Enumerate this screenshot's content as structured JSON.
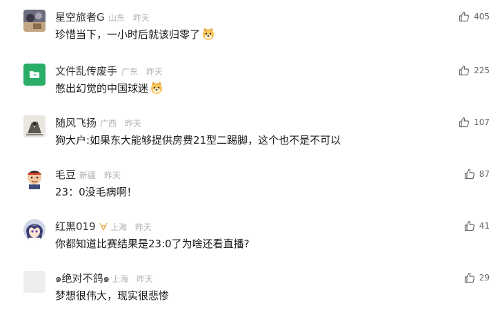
{
  "comments": [
    {
      "name": "星空旅者G",
      "location": "山东",
      "time": "昨天",
      "text": "珍惜当下，一小时后就该归零了",
      "likes": "405",
      "avatar": "photo-avatar",
      "emoji": "dog-face-emoji"
    },
    {
      "name": "文件乱传废手",
      "location": "广东",
      "time": "昨天",
      "text": "憋出幻觉的中国球迷",
      "likes": "225",
      "avatar": "folder-icon",
      "emoji": "dog-face-emoji"
    },
    {
      "name": "随风飞扬",
      "location": "广西",
      "time": "昨天",
      "text": "狗大户:如果东大能够提供房费21型二踢脚，这个也不是不可以",
      "likes": "107",
      "avatar": "photo-avatar"
    },
    {
      "name": "毛豆",
      "location": "新疆",
      "time": "昨天",
      "text": "23：0没毛病啊！",
      "likes": "87",
      "avatar": "cartoon-avatar"
    },
    {
      "name": "红黑019",
      "location": "上海",
      "time": "昨天",
      "text": "你都知道比赛结果是23:0了为啥还看直播?",
      "likes": "41",
      "avatar": "anime-avatar",
      "badge": "ribbon-badge-icon"
    },
    {
      "name": "๑绝对不鸽๑",
      "location": "上海",
      "time": "昨天",
      "text": "梦想很伟大，现实很悲惨",
      "likes": "29",
      "avatar": "blank-avatar"
    }
  ],
  "colors": {
    "folder_green": "#2aae67",
    "like_gray": "#666666",
    "meta_gray": "#b2b2b2",
    "badge_gold": "#e8b04a"
  }
}
